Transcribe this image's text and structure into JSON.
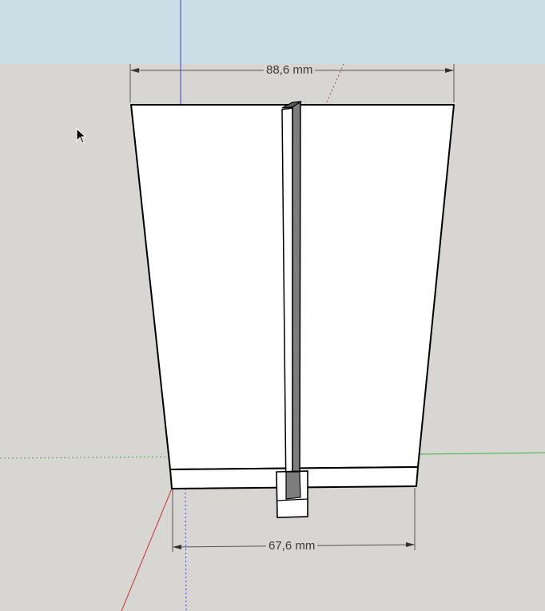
{
  "viewport": {
    "sky_color": "#cbdfe6",
    "ground_color": "#d7d6d2",
    "axis_colors": {
      "blue": "#3f3fcf",
      "red": "#d03030",
      "green": "#40b040"
    }
  },
  "model": {
    "face_color": "#ffffff",
    "edge_color": "#000000",
    "shadow_face_color": "#7d7d7d"
  },
  "dimensions": {
    "top_label": "88,6 mm",
    "bottom_label": "67,6 mm"
  },
  "cursor": {
    "icon": "arrow-pointer-icon"
  }
}
